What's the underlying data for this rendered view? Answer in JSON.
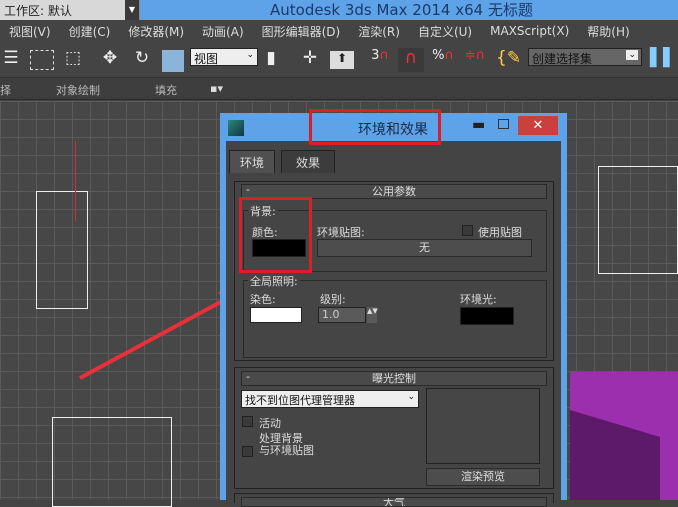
{
  "app": {
    "workspace": "工作区: 默认",
    "title": "Autodesk 3ds Max 2014 x64    无标题"
  },
  "menu": [
    "视图(V)",
    "创建(C)",
    "修改器(M)",
    "动画(A)",
    "图形编辑器(D)",
    "渲染(R)",
    "自定义(U)",
    "MAXScript(X)",
    "帮助(H)"
  ],
  "toolbar": {
    "coord_system": "视图",
    "named_selection": "创建选择集",
    "snap_3": "3",
    "snap_percent": "%"
  },
  "ribbon": [
    "择",
    "对象绘制",
    "填充"
  ],
  "dialog": {
    "title": "环境和效果",
    "tabs": [
      "环境",
      "效果"
    ],
    "common": {
      "header": "公用参数",
      "background_label": "背景:",
      "color_label": "颜色:",
      "background_color": "#000000",
      "env_map_label": "环境贴图:",
      "use_map_label": "使用贴图",
      "env_map_button": "无",
      "global_lighting_label": "全局照明:",
      "tint_label": "染色:",
      "tint_color": "#ffffff",
      "level_label": "级别:",
      "level_value": "1.0",
      "ambient_label": "环境光:",
      "ambient_color": "#000000"
    },
    "exposure": {
      "header": "曝光控制",
      "dropdown": "找不到位图代理管理器",
      "active_label": "活动",
      "process_bg_label_1": "处理背景",
      "process_bg_label_2": "与环境贴图",
      "render_preview": "渲染预览"
    },
    "atmosphere": {
      "header": "大气"
    }
  },
  "colors": {
    "highlight": "#d8202a",
    "title_blue": "#5ea2e8"
  }
}
